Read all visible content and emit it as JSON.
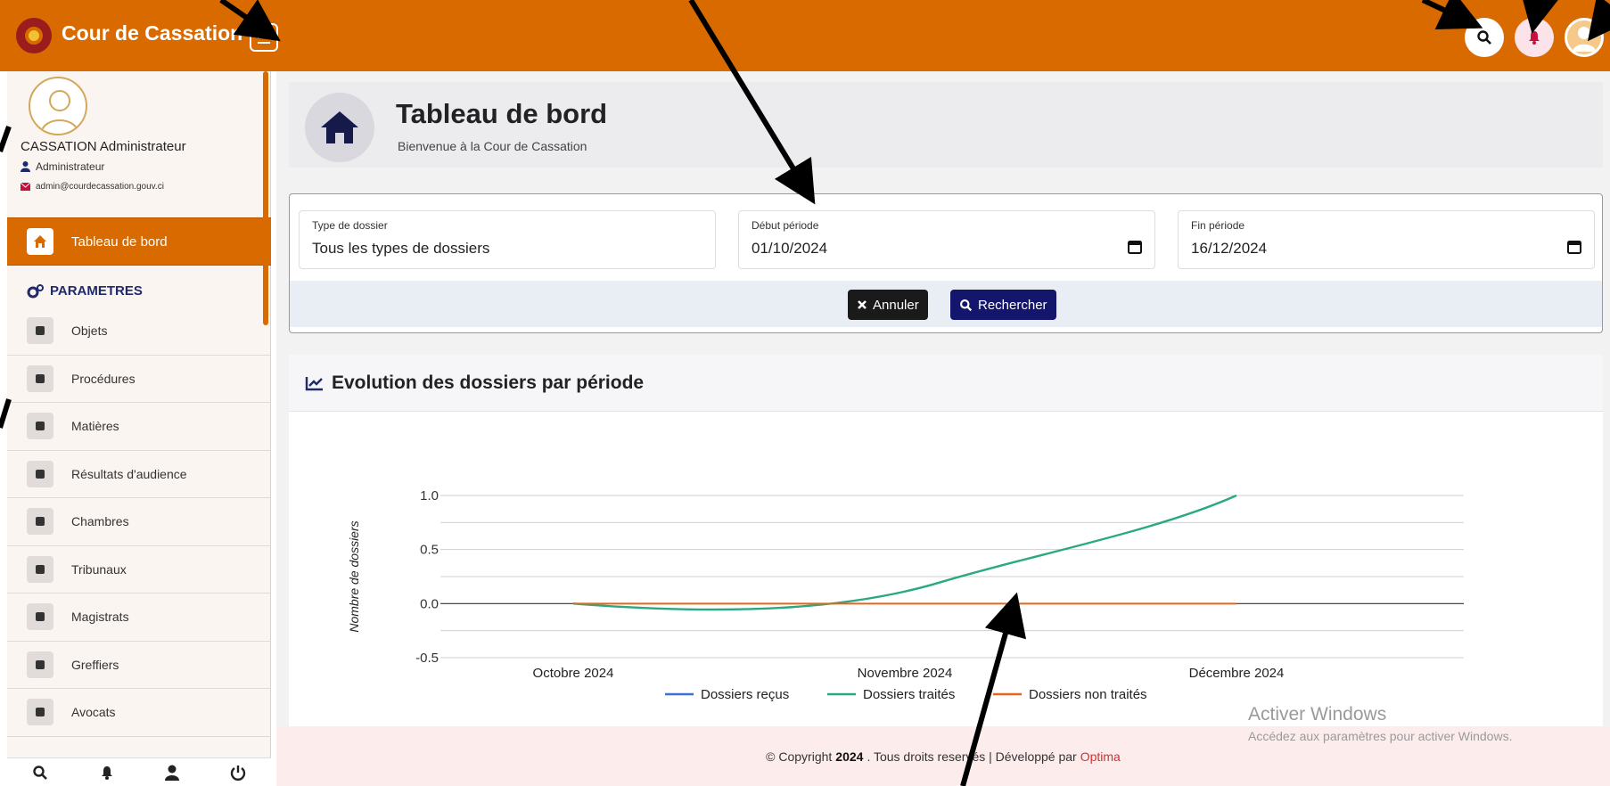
{
  "app": {
    "brand": "Cour de Cassation"
  },
  "user": {
    "name": "CASSATION Administrateur",
    "role": "Administrateur",
    "email": "admin@courdecassation.gouv.ci"
  },
  "sidebar": {
    "active_item": "Tableau de bord",
    "section_title": "PARAMETRES",
    "items": [
      {
        "label": "Objets",
        "icon": "target-icon"
      },
      {
        "label": "Procédures",
        "icon": "layers-icon"
      },
      {
        "label": "Matières",
        "icon": "folder-icon"
      },
      {
        "label": "Résultats d'audience",
        "icon": "gavel-icon"
      },
      {
        "label": "Chambres",
        "icon": "building-icon"
      },
      {
        "label": "Tribunaux",
        "icon": "scale-icon"
      },
      {
        "label": "Magistrats",
        "icon": "judge-icon"
      },
      {
        "label": "Greffiers",
        "icon": "clerk-icon"
      },
      {
        "label": "Avocats",
        "icon": "lawyer-icon"
      }
    ]
  },
  "header": {
    "title": "Tableau de bord",
    "subtitle": "Bienvenue à la Cour de Cassation"
  },
  "filters": {
    "type": {
      "label": "Type de dossier",
      "value": "Tous les types de dossiers"
    },
    "start": {
      "label": "Début période",
      "value": "01/10/2024"
    },
    "end": {
      "label": "Fin période",
      "value": "16/12/2024"
    },
    "cancel_label": "Annuler",
    "search_label": "Rechercher"
  },
  "chart_section": {
    "title": "Evolution des dossiers par période"
  },
  "chart_data": {
    "type": "line",
    "title": "Evolution des dossiers par période",
    "xlabel": "",
    "ylabel": "Nombre de dossiers",
    "categories": [
      "Octobre 2024",
      "Novembre 2024",
      "Décembre 2024"
    ],
    "ylim": [
      -0.5,
      1.0
    ],
    "yticks": [
      "1.0",
      "0.5",
      "0.0",
      "-0.5"
    ],
    "legend_position": "bottom",
    "grid": true,
    "series": [
      {
        "name": "Dossiers reçus",
        "values": [
          0,
          0,
          1
        ],
        "color": "#3b6fd1"
      },
      {
        "name": "Dossiers traités",
        "values": [
          0,
          0,
          1
        ],
        "color": "#2aa884"
      },
      {
        "name": "Dossiers non traités",
        "values": [
          0,
          0,
          0
        ],
        "color": "#e0671c"
      }
    ]
  },
  "footer": {
    "copyright": "© Copyright",
    "year": "2024",
    "rights": ". Tous droits reservés | Développé par",
    "developer": "Optima"
  },
  "watermark": {
    "line1": "Activer Windows",
    "line2": "Accédez aux paramètres pour activer Windows."
  },
  "colors": {
    "accent": "#d96a00",
    "navy": "#13166b"
  }
}
